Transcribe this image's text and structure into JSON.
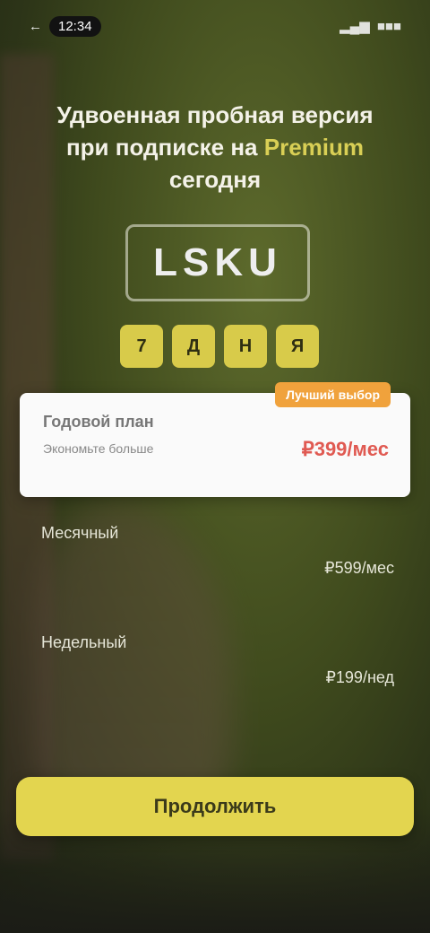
{
  "status_bar": {
    "time": "12:34",
    "signal": "▂▄▆",
    "battery": "■■■"
  },
  "headline": {
    "line1": "Удвоенная пробная версия",
    "line2": "при подписке на",
    "accent": "Premium",
    "line3": "сегодня"
  },
  "logo": {
    "text": "LSKU"
  },
  "badges": [
    "7",
    "Д",
    "Н",
    "Я"
  ],
  "plan": {
    "tag": "Лучший выбор",
    "name": "Годовой план",
    "subtitle": "Экономьте больше",
    "price": "₽399/мес"
  },
  "options": [
    {
      "label": "Месячный",
      "price": "₽599/мес"
    },
    {
      "label": "Недельный",
      "price": "₽199/нед"
    }
  ],
  "cta": {
    "label": "Продолжить"
  },
  "colors": {
    "accent": "#d9cf55",
    "cta": "#e3d54f",
    "tag": "#f0a23c",
    "price": "#e05a52"
  }
}
